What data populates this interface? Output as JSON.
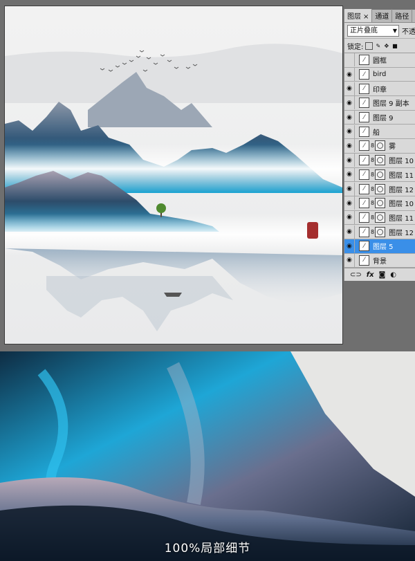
{
  "panel": {
    "tabs": [
      {
        "label": "图层",
        "close": "×"
      },
      {
        "label": "通道"
      },
      {
        "label": "路径"
      }
    ],
    "blend_mode": "正片叠底",
    "opacity_label": "不透",
    "lock_label": "锁定:",
    "layers": [
      {
        "name": "圆框",
        "visible": false,
        "mask": false
      },
      {
        "name": "bird",
        "visible": true,
        "mask": false
      },
      {
        "name": "印章",
        "visible": true,
        "mask": false
      },
      {
        "name": "图层 9 副本",
        "visible": true,
        "mask": false
      },
      {
        "name": "图层 9",
        "visible": true,
        "mask": false
      },
      {
        "name": "船",
        "visible": true,
        "mask": false
      },
      {
        "name": "雾",
        "visible": true,
        "mask": true
      },
      {
        "name": "图层 10",
        "visible": true,
        "mask": true
      },
      {
        "name": "图层 11",
        "visible": true,
        "mask": true
      },
      {
        "name": "图层 12",
        "visible": true,
        "mask": true
      },
      {
        "name": "图层 10",
        "visible": true,
        "mask": true
      },
      {
        "name": "图层 11",
        "visible": true,
        "mask": true
      },
      {
        "name": "图层 12",
        "visible": true,
        "mask": true
      },
      {
        "name": "图层 5",
        "visible": true,
        "mask": false,
        "selected": true
      },
      {
        "name": "背景",
        "visible": true,
        "mask": false
      }
    ],
    "footer_icons": [
      "link-icon",
      "fx-icon",
      "mask-icon",
      "adjustment-icon"
    ],
    "footer_fx": "fx"
  },
  "detail": {
    "caption": "100%局部细节"
  },
  "colors": {
    "selection": "#3a8fe8",
    "mountain_dark": "#1f3b55",
    "mountain_cyan": "#1fa5d8"
  }
}
